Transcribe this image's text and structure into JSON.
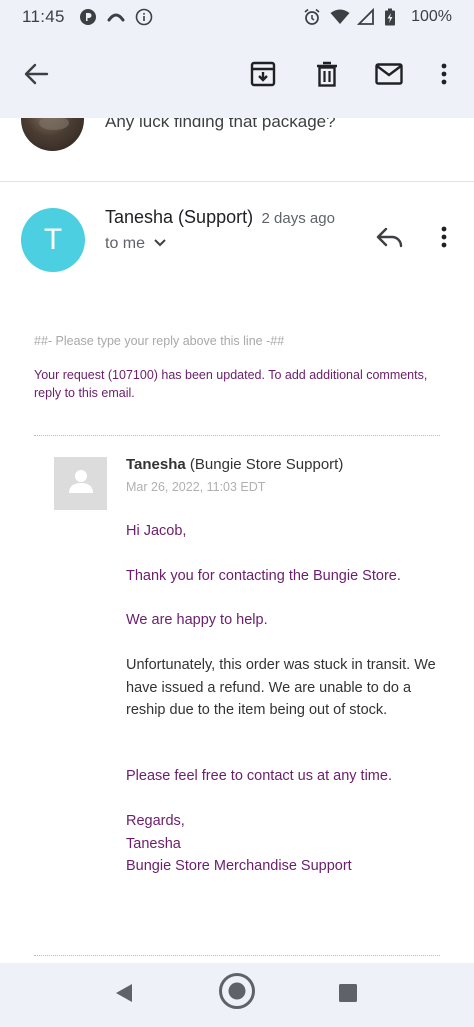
{
  "status_bar": {
    "time": "11:45",
    "battery": "100%"
  },
  "prev_message": {
    "snippet": "Any luck finding that package?"
  },
  "message": {
    "sender_initial": "T",
    "sender_name": "Tanesha (Support)",
    "time_ago": "2 days ago",
    "to_label": "to me",
    "avatar_color": "#4cd0e1"
  },
  "body": {
    "reply_line": "##- Please type your reply above this line -##",
    "update_notice": "Your request (107100) has been updated. To add additional comments, reply to this email.",
    "agent_first": "Tanesha",
    "agent_org": " (Bungie Store Support)",
    "date": "Mar 26, 2022, 11:03 EDT",
    "greeting": "Hi Jacob,",
    "thanks": "Thank you for contacting the Bungie Store.",
    "happy": "We are happy to help.",
    "unfortunately": "Unfortunately, this order was stuck in transit. We have issued a refund. We are unable to do a reship due to the item being out of stock.",
    "contact": "Please feel free to contact us at any time.",
    "regards": "Regards,",
    "sign_name": "Tanesha",
    "sign_team": "Bungie Store Merchandise Support"
  },
  "colors": {
    "bar_bg": "#eef2f8",
    "accent_purple": "#6b1e6b"
  }
}
